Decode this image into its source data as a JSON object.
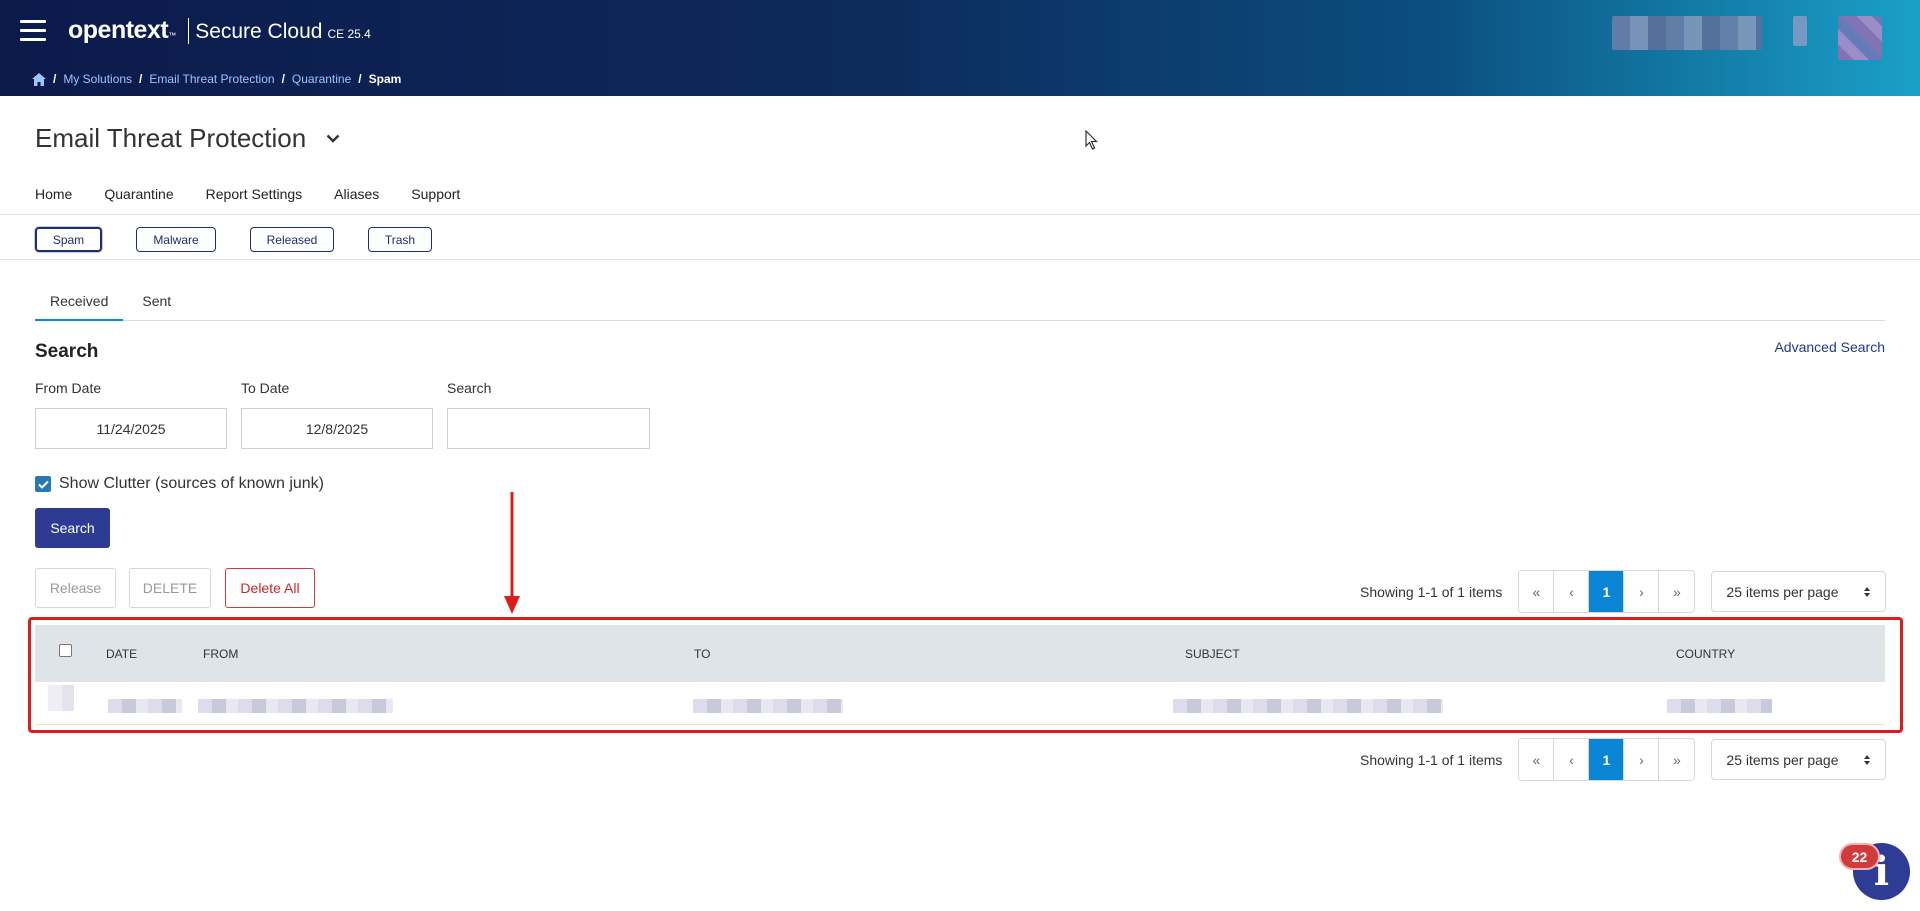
{
  "header": {
    "brand": "opentext",
    "brand_tm": "™",
    "product": "Secure Cloud",
    "version": "CE 25.4"
  },
  "breadcrumb": {
    "items": [
      "My Solutions",
      "Email Threat Protection",
      "Quarantine"
    ],
    "current": "Spam"
  },
  "page": {
    "title": "Email Threat Protection"
  },
  "nav": {
    "items": [
      "Home",
      "Quarantine",
      "Report Settings",
      "Aliases",
      "Support"
    ]
  },
  "chips": {
    "items": [
      "Spam",
      "Malware",
      "Released",
      "Trash"
    ],
    "active": "Spam"
  },
  "tabs": {
    "items": [
      "Received",
      "Sent"
    ],
    "active": "Received"
  },
  "search": {
    "heading": "Search",
    "advanced": "Advanced Search",
    "from_label": "From Date",
    "from_value": "11/24/2025",
    "to_label": "To Date",
    "to_value": "12/8/2025",
    "query_label": "Search",
    "query_value": "",
    "clutter_label": "Show Clutter (sources of known junk)",
    "clutter_checked": true,
    "button": "Search"
  },
  "actions": {
    "release": "Release",
    "delete": "DELETE",
    "delete_all": "Delete All"
  },
  "pagination": {
    "info": "Showing 1-1 of 1 items",
    "current_page": "1",
    "per_page": "25 items per page"
  },
  "table": {
    "columns": [
      "DATE",
      "FROM",
      "TO",
      "SUBJECT",
      "COUNTRY"
    ]
  },
  "help": {
    "badge_count": "22",
    "icon_glyph": "i"
  },
  "colors": {
    "accent": "#0a84d4",
    "primary_button": "#2d3b92",
    "danger": "#c62828",
    "highlight": "#e01b1b"
  }
}
